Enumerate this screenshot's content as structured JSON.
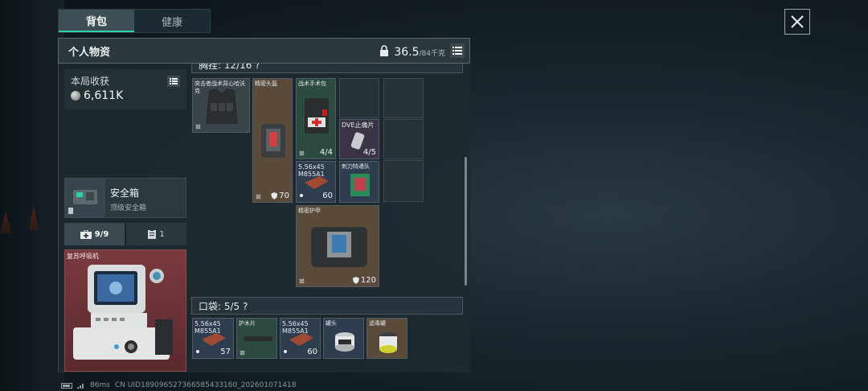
{
  "tabs": [
    {
      "label": "背包",
      "active": true
    },
    {
      "label": "健康",
      "active": false
    }
  ],
  "header": {
    "title": "个人物资",
    "weight_current": "36.5",
    "weight_max": "/84千克"
  },
  "earnings": {
    "title": "本局收获",
    "value": "6,611K"
  },
  "safe_box": {
    "name": "安全箱",
    "subtitle": "顶级安全箱"
  },
  "subtabs": [
    {
      "label": "9/9",
      "icon": "medkit-icon",
      "active": true
    },
    {
      "label": "1",
      "icon": "clipboard-icon",
      "active": false
    }
  ],
  "revive_item": {
    "name": "复苏呼吸机"
  },
  "chest_section": {
    "label": "胸挂: 12/16 ?"
  },
  "chest_items": [
    {
      "name": "突击者战术背心哈沃克",
      "tag": "⊠"
    },
    {
      "name": "精密头盔",
      "tag": "⊠",
      "durability": "70"
    },
    {
      "name": "战术手术包",
      "tag": "⊠",
      "count": "4/4"
    },
    {
      "name": "DVE止痛片",
      "count": "4/5"
    },
    {
      "name": "5.56x45 M855A1",
      "count": "60"
    },
    {
      "name": "刺刀特遣队",
      "count": ""
    },
    {
      "name": "精密护甲",
      "tag": "⊠",
      "durability": "120"
    }
  ],
  "pocket_section": {
    "label": "口袋: 5/5 ?"
  },
  "pocket_items": [
    {
      "name": "5.56x45 M855A1",
      "count": "57"
    },
    {
      "name": "护木片",
      "tag": "⊠"
    },
    {
      "name": "5.56x45 M855A1",
      "count": "60"
    },
    {
      "name": "罐头"
    },
    {
      "name": "滤毒罐"
    }
  ],
  "status_bar": {
    "ping": "86ms",
    "uid": "CN UID18909652736658543316​0_202601071418"
  },
  "colors": {
    "accent": "#2ad3a8",
    "revive_bg": "#7a3a3e"
  }
}
